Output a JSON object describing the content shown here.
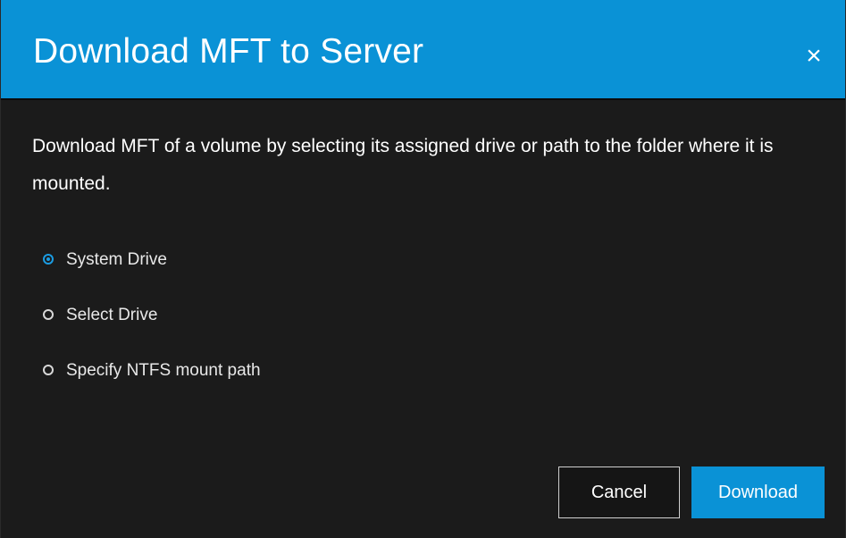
{
  "dialog": {
    "title": "Download MFT to Server",
    "close_symbol": "×",
    "description": "Download MFT of a volume by selecting its assigned drive or path to the folder where it is mounted."
  },
  "options": [
    {
      "label": "System Drive",
      "checked": true
    },
    {
      "label": "Select Drive",
      "checked": false
    },
    {
      "label": "Specify NTFS mount path",
      "checked": false
    }
  ],
  "buttons": {
    "cancel_label": "Cancel",
    "download_label": "Download"
  },
  "colors": {
    "header": "#0a92d6",
    "background": "#1b1b1b",
    "accent": "#1b9ce2"
  },
  "icons": {
    "close": "close-icon",
    "radio_selected": "radio-checked-icon",
    "radio_unselected": "radio-unchecked-icon"
  }
}
